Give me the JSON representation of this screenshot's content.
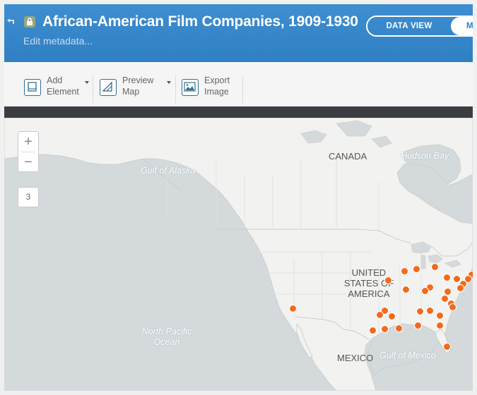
{
  "header": {
    "title": "African-American Film Companies, 1909-1930",
    "subtitle": "Edit metadata...",
    "toggle_left": "DATA VIEW",
    "toggle_right": "M"
  },
  "toolbar": {
    "add_element": "Add\nElement",
    "preview_map": "Preview\nMap",
    "export_image": "Export\nImage"
  },
  "map": {
    "zoom_in": "+",
    "zoom_out": "−",
    "zoom_level": "3",
    "labels": {
      "canada": "CANADA",
      "hudson_bay": "Hudson Bay",
      "gulf_alaska": "Gulf of Alaska",
      "usa": "UNITED\nSTATES OF\nAMERICA",
      "north_pacific": "North Pacific\nOcean",
      "mexico": "MEXICO",
      "gulf_mexico": "Gulf of Mexico"
    },
    "colors": {
      "point": "#f26b1d",
      "water": "#d4dadc",
      "land": "#f2f2f0"
    }
  }
}
